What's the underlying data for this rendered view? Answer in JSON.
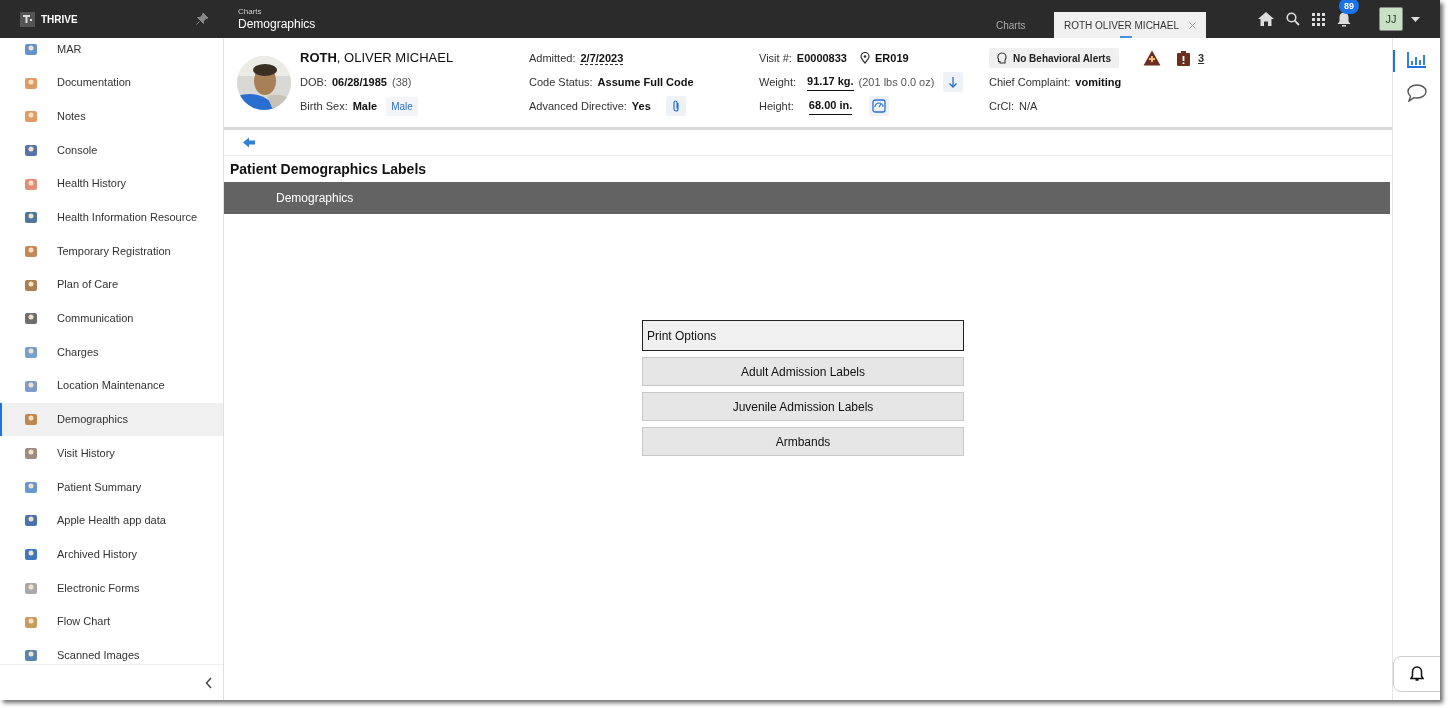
{
  "topbar": {
    "logo": "THRIVE",
    "breadcrumb": "Charts",
    "title": "Demographics",
    "tabs": [
      {
        "label": "Charts",
        "selected": false
      },
      {
        "label": "ROTH OLIVER MICHAEL",
        "selected": true
      }
    ],
    "notification_count": "89",
    "avatar": "JJ"
  },
  "sidebar": {
    "items": [
      {
        "label": "MAR",
        "selected": false
      },
      {
        "label": "Documentation",
        "selected": false
      },
      {
        "label": "Notes",
        "selected": false
      },
      {
        "label": "Console",
        "selected": false
      },
      {
        "label": "Health History",
        "selected": false
      },
      {
        "label": "Health Information Resource",
        "selected": false
      },
      {
        "label": "Temporary Registration",
        "selected": false
      },
      {
        "label": "Plan of Care",
        "selected": false
      },
      {
        "label": "Communication",
        "selected": false
      },
      {
        "label": "Charges",
        "selected": false
      },
      {
        "label": "Location Maintenance",
        "selected": false
      },
      {
        "label": "Demographics",
        "selected": true
      },
      {
        "label": "Visit History",
        "selected": false
      },
      {
        "label": "Patient Summary",
        "selected": false
      },
      {
        "label": "Apple Health app data",
        "selected": false
      },
      {
        "label": "Archived History",
        "selected": false
      },
      {
        "label": "Electronic Forms",
        "selected": false
      },
      {
        "label": "Flow Chart",
        "selected": false
      },
      {
        "label": "Scanned Images",
        "selected": false
      }
    ]
  },
  "patient": {
    "name": "**ROTH**, OLIVER MICHAEL",
    "dob_label": "DOB:",
    "dob": "06/28/1985",
    "age": "(38)",
    "sex_label": "Birth Sex:",
    "sex": "Male",
    "sex_tag": "Male",
    "admitted_label": "Admitted:",
    "admitted": "2/7/2023",
    "code_status_label": "Code Status:",
    "code_status": "Assume Full Code",
    "directive_label": "Advanced Directive:",
    "directive": "Yes",
    "visit_label": "Visit #:",
    "visit": "E0000833",
    "location": "ER019",
    "weight_label": "Weight:",
    "weight": "91.17 kg.",
    "weight_alt": "(201 lbs 0.0 oz)",
    "height_label": "Height:",
    "height": "68.00 in.",
    "behavioral_alerts": "No Behavioral Alerts",
    "alert_count": "3",
    "complaint_label": "Chief Complaint:",
    "complaint": "vomiting",
    "crcl_label": "CrCl:",
    "crcl": "N/A"
  },
  "page": {
    "title": "Patient Demographics Labels",
    "section": "Demographics",
    "print_options": "Print Options",
    "buttons": [
      "Adult Admission Labels",
      "Juvenile Admission Labels",
      "Armbands"
    ]
  }
}
